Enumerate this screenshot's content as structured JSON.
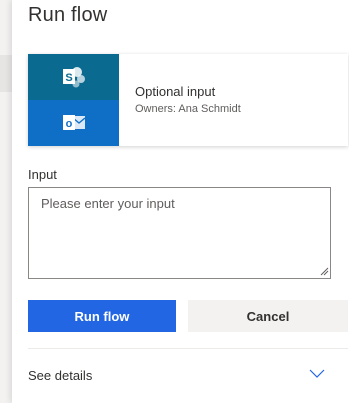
{
  "panel": {
    "title": "Run flow"
  },
  "flow_card": {
    "name": "Optional input",
    "owners": "Owners: Ana Schmidt",
    "icons": [
      "sharepoint-icon",
      "outlook-icon"
    ],
    "colors": {
      "sharepoint": "#0b6a8f",
      "outlook": "#0f6fc6"
    }
  },
  "input": {
    "label": "Input",
    "placeholder": "Please enter your input",
    "value": ""
  },
  "actions": {
    "run_label": "Run flow",
    "cancel_label": "Cancel",
    "run_color": "#2266e3"
  },
  "details": {
    "label": "See details",
    "icon": "chevron-down-icon"
  }
}
